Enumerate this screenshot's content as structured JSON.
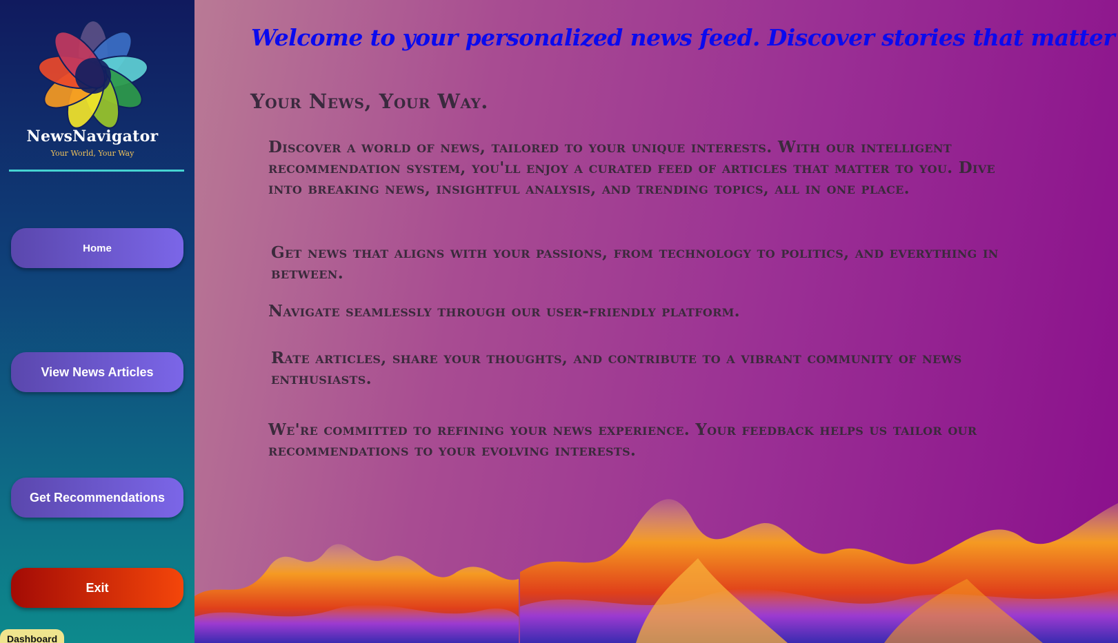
{
  "sidebar": {
    "brand_name": "NewsNavigator",
    "brand_tagline": "Your World, Your Way",
    "logo_icon": "flower-wheel-logo-icon",
    "buttons": {
      "home": "Home",
      "view_articles": "View News Articles",
      "recommendations": "Get Recommendations",
      "exit": "Exit"
    },
    "dashboard_tab": "Dashboard"
  },
  "main": {
    "welcome": "Welcome to your personalized news feed. Discover stories that matter to you",
    "headline": "Your News, Your Way.",
    "paragraphs": [
      "Discover a world of news, tailored to your unique interests. With our intelligent recommendation system, you'll enjoy a curated feed of articles that matter to you. Dive into breaking news, insightful analysis, and trending topics, all in one place.",
      "Get news that aligns with your passions, from technology to politics, and everything in between.",
      "Navigate seamlessly through our user-friendly platform.",
      "Rate articles, share your thoughts, and contribute to a vibrant community of news enthusiasts.",
      "We're committed to refining your news experience. Your feedback helps us tailor our recommendations to your evolving interests."
    ],
    "background_image": "flames-image"
  },
  "colors": {
    "welcome_text": "#0a0aee",
    "body_text": "#3b2a3c",
    "nav_button": "#6b58d0",
    "exit_button": "#e2390a",
    "divider": "#46d4d2",
    "dashboard_tab": "#efe48e"
  }
}
